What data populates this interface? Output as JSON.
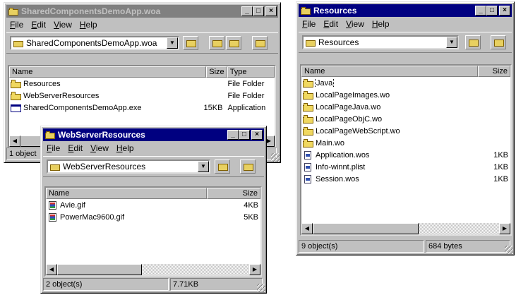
{
  "window1": {
    "title": "SharedComponentsDemoApp.woa",
    "menu": [
      "File",
      "Edit",
      "View",
      "Help"
    ],
    "address": "SharedComponentsDemoApp.woa",
    "columns": [
      "Name",
      "Size",
      "Type"
    ],
    "rows": [
      {
        "name": "Resources",
        "size": "",
        "type": "File Folder",
        "icon": "folder-icon"
      },
      {
        "name": "WebServerResources",
        "size": "",
        "type": "File Folder",
        "icon": "folder-icon"
      },
      {
        "name": "SharedComponentsDemoApp.exe",
        "size": "15KB",
        "type": "Application",
        "icon": "application-icon"
      }
    ],
    "status": "1 object"
  },
  "window2": {
    "title": "Resources",
    "menu": [
      "File",
      "Edit",
      "View",
      "Help"
    ],
    "address": "Resources",
    "columns": [
      "Name",
      "Size"
    ],
    "rows": [
      {
        "name": "Java",
        "size": "",
        "icon": "folder-icon"
      },
      {
        "name": "LocalPageImages.wo",
        "size": "",
        "icon": "folder-icon"
      },
      {
        "name": "LocalPageJava.wo",
        "size": "",
        "icon": "folder-icon"
      },
      {
        "name": "LocalPageObjC.wo",
        "size": "",
        "icon": "folder-icon"
      },
      {
        "name": "LocalPageWebScript.wo",
        "size": "",
        "icon": "folder-icon"
      },
      {
        "name": "Main.wo",
        "size": "",
        "icon": "folder-icon"
      },
      {
        "name": "Application.wos",
        "size": "1KB",
        "icon": "file-icon"
      },
      {
        "name": "Info-winnt.plist",
        "size": "1KB",
        "icon": "file-icon"
      },
      {
        "name": "Session.wos",
        "size": "1KB",
        "icon": "file-icon"
      }
    ],
    "status": [
      "9 object(s)",
      "684 bytes"
    ]
  },
  "window3": {
    "title": "WebServerResources",
    "menu": [
      "File",
      "Edit",
      "View",
      "Help"
    ],
    "address": "WebServerResources",
    "columns": [
      "Name",
      "Size"
    ],
    "rows": [
      {
        "name": "Avie.gif",
        "size": "4KB",
        "icon": "gif-image-icon"
      },
      {
        "name": "PowerMac9600.gif",
        "size": "5KB",
        "icon": "gif-image-icon"
      }
    ],
    "status": [
      "2 object(s)",
      "7.71KB"
    ]
  },
  "colors": {
    "active_title": "#000080",
    "inactive_title": "#808080",
    "face": "#c0c0c0"
  }
}
